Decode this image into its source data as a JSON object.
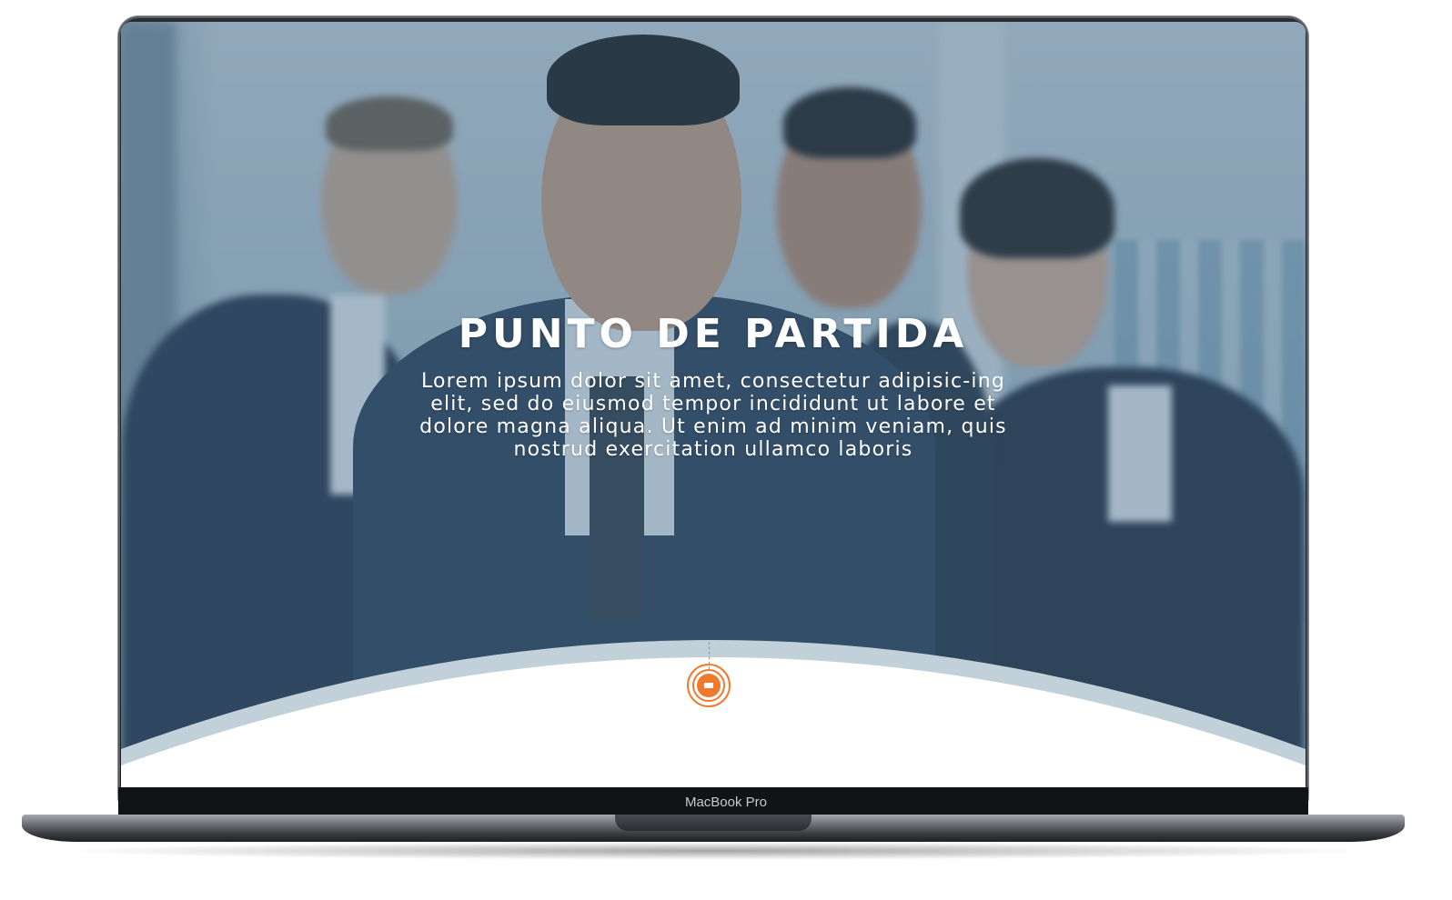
{
  "hero": {
    "title": "PUNTO DE PARTIDA",
    "body": "Lorem ipsum dolor sit amet, consectetur adipisic-ing elit, sed do eiusmod tempor incididunt ut labore et dolore magna aliqua. Ut enim ad minim veniam, quis nostrud exercitation ullamco laboris"
  },
  "scroll_button": {
    "icon": "scroll-down-icon",
    "color": "#f07a2c"
  },
  "device": {
    "brand_label": "MacBook Pro"
  },
  "colors": {
    "overlay": "#466e8c",
    "accent": "#f07a2c",
    "arc_band": "#c2d1d9"
  }
}
